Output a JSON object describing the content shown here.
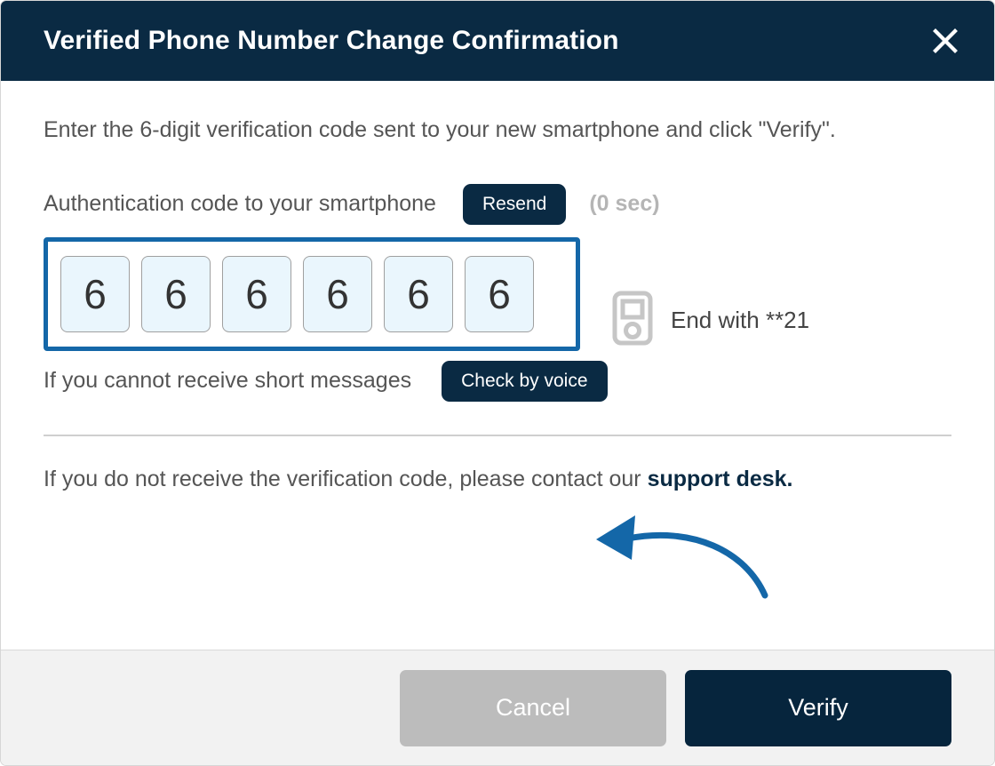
{
  "dialog": {
    "title": "Verified Phone Number Change Confirmation",
    "close_icon": "close-icon",
    "intro": "Enter the 6-digit verification code sent to your new smartphone and click \"Verify\".",
    "accent_header_color": "#0a2a43",
    "focus_ring_color": "#1467a8",
    "annotation_arrow_color": "#1467a8"
  },
  "auth": {
    "label": "Authentication code to your smartphone",
    "resend_label": "Resend",
    "timer": "(0 sec)",
    "code_digits": [
      "6",
      "6",
      "6",
      "6",
      "6",
      "6"
    ],
    "code_placeholder": "",
    "device_icon": "mobile-device-icon",
    "device_text": "End with **21"
  },
  "voice": {
    "label": "If you cannot receive short messages",
    "button_label": "Check by voice"
  },
  "support": {
    "text_prefix": "If you do not receive the verification code, please contact our ",
    "link_label": "support desk."
  },
  "footer": {
    "cancel_label": "Cancel",
    "verify_label": "Verify",
    "cancel_color": "#bcbcbc",
    "verify_color": "#06253d"
  }
}
